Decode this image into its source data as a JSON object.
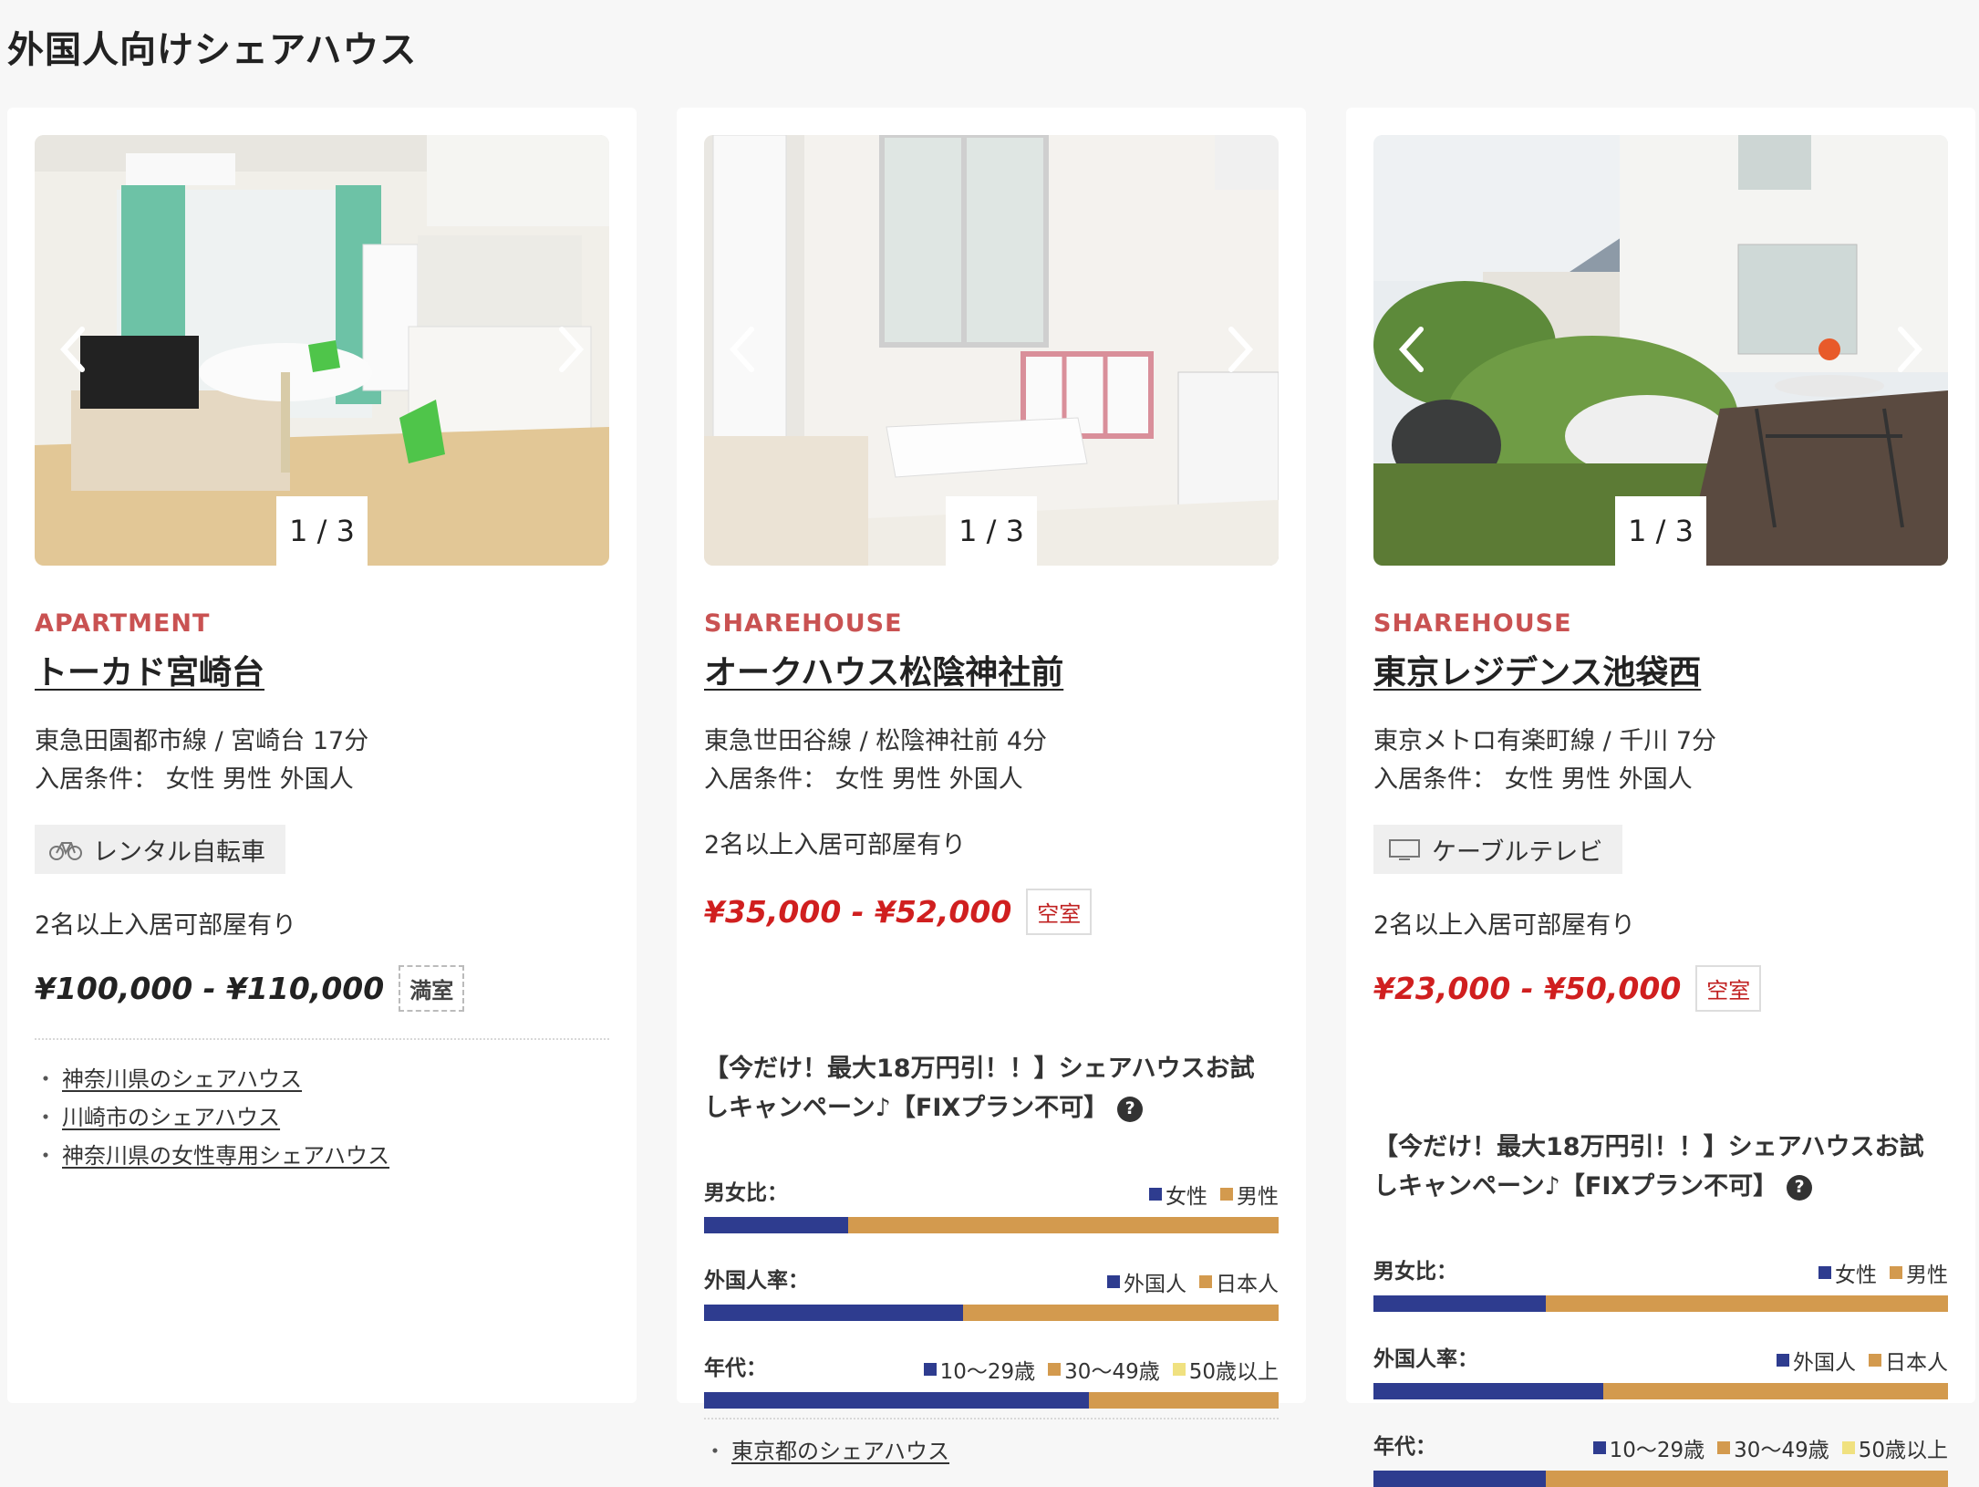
{
  "page_title": "外国人向けシェアハウス",
  "colors": {
    "type_label": "#c95252",
    "price_red": "#d01f1f",
    "navy": "#2e3c8f",
    "orange": "#d39a4e",
    "yellow": "#f0e180"
  },
  "cards": [
    {
      "photo_counter": "1 / 3",
      "type": "APARTMENT",
      "name": "トーカド宮崎台",
      "station": "東急田園都市線 / 宮崎台 17分",
      "conditions": "入居条件： 女性 男性 外国人",
      "amenity": {
        "icon": "bicycle-icon",
        "label": "レンタル自転車"
      },
      "multi_occupancy": "2名以上入居可部屋有り",
      "price": "¥100,000 - ¥110,000",
      "availability": "満室",
      "links": [
        "神奈川県のシェアハウス",
        "川崎市のシェアハウス",
        "神奈川県の女性専用シェアハウス"
      ]
    },
    {
      "photo_counter": "1 / 3",
      "type": "SHAREHOUSE",
      "name": "オークハウス松陰神社前",
      "station": "東急世田谷線 / 松陰神社前 4分",
      "conditions": "入居条件： 女性 男性 外国人",
      "multi_occupancy": "2名以上入居可部屋有り",
      "price": "¥35,000 - ¥52,000",
      "availability": "空室",
      "campaign": "【今だけ！最大18万円引！！】シェアハウスお試しキャンペーン♪【FIXプラン不可】",
      "stats": {
        "gender": {
          "label": "男女比：",
          "legend": [
            "女性",
            "男性"
          ],
          "values": [
            0.25,
            0.75
          ]
        },
        "foreign": {
          "label": "外国人率：",
          "legend": [
            "外国人",
            "日本人"
          ],
          "values": [
            0.45,
            0.55
          ]
        },
        "age": {
          "label": "年代：",
          "legend": [
            "10〜29歳",
            "30〜49歳",
            "50歳以上"
          ],
          "values": [
            0.67,
            0.33,
            0
          ]
        }
      },
      "links": [
        "東京都のシェアハウス"
      ]
    },
    {
      "photo_counter": "1 / 3",
      "type": "SHAREHOUSE",
      "name": "東京レジデンス池袋西",
      "station": "東京メトロ有楽町線 / 千川 7分",
      "conditions": "入居条件： 女性 男性 外国人",
      "amenity": {
        "icon": "tv-icon",
        "label": "ケーブルテレビ"
      },
      "multi_occupancy": "2名以上入居可部屋有り",
      "price": "¥23,000 - ¥50,000",
      "availability": "空室",
      "campaign": "【今だけ！最大18万円引！！】シェアハウスお試しキャンペーン♪【FIXプラン不可】",
      "stats": {
        "gender": {
          "label": "男女比：",
          "legend": [
            "女性",
            "男性"
          ],
          "values": [
            0.3,
            0.7
          ]
        },
        "foreign": {
          "label": "外国人率：",
          "legend": [
            "外国人",
            "日本人"
          ],
          "values": [
            0.4,
            0.6
          ]
        },
        "age": {
          "label": "年代：",
          "legend": [
            "10〜29歳",
            "30〜49歳",
            "50歳以上"
          ],
          "values": [
            0.3,
            0.7,
            0
          ]
        }
      }
    }
  ]
}
